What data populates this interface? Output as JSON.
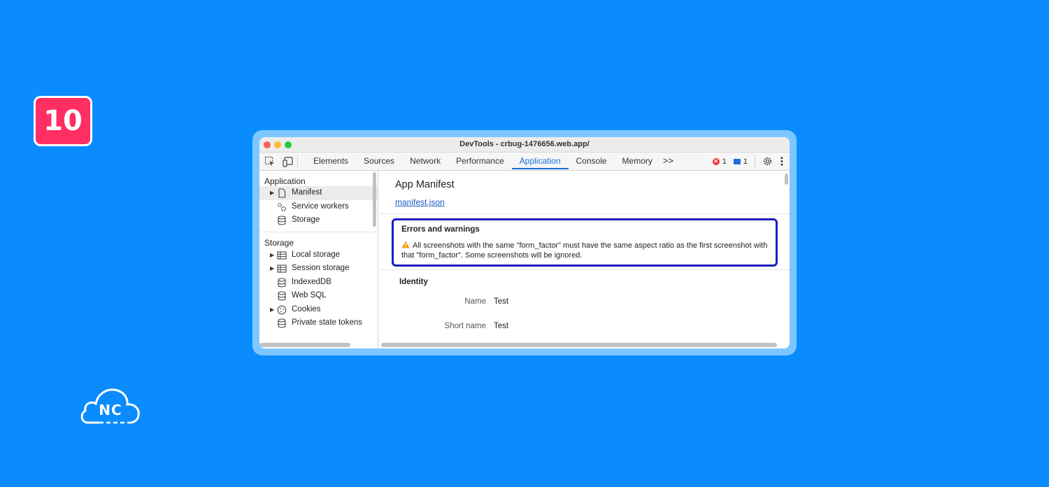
{
  "badge": "10",
  "logo_text": "NC",
  "window": {
    "title": "DevTools - crbug-1476656.web.app/"
  },
  "toolbar": {
    "tabs": [
      {
        "label": "Elements"
      },
      {
        "label": "Sources"
      },
      {
        "label": "Network"
      },
      {
        "label": "Performance"
      },
      {
        "label": "Application"
      },
      {
        "label": "Console"
      },
      {
        "label": "Memory"
      }
    ],
    "active_tab": "Application",
    "error_count": "1",
    "message_count": "1"
  },
  "sidebar": {
    "application_header": "Application",
    "application_items": [
      {
        "label": "Manifest",
        "icon": "file-icon",
        "expandable": true
      },
      {
        "label": "Service workers",
        "icon": "gears-icon",
        "expandable": false
      },
      {
        "label": "Storage",
        "icon": "database-icon",
        "expandable": false
      }
    ],
    "storage_header": "Storage",
    "storage_items": [
      {
        "label": "Local storage",
        "icon": "table-icon",
        "expandable": true
      },
      {
        "label": "Session storage",
        "icon": "table-icon",
        "expandable": true
      },
      {
        "label": "IndexedDB",
        "icon": "database-icon",
        "expandable": false
      },
      {
        "label": "Web SQL",
        "icon": "database-icon",
        "expandable": false
      },
      {
        "label": "Cookies",
        "icon": "cookie-icon",
        "expandable": true
      },
      {
        "label": "Private state tokens",
        "icon": "database-icon",
        "expandable": false
      }
    ]
  },
  "main": {
    "title": "App Manifest",
    "link": "manifest.json",
    "errors_heading": "Errors and warnings",
    "warning_text": "All screenshots with the same \"form_factor\" must have the same aspect ratio as the first screenshot with that \"form_factor\". Some screenshots will be ignored.",
    "identity_heading": "Identity",
    "rows": [
      {
        "label": "Name",
        "value": "Test"
      },
      {
        "label": "Short name",
        "value": "Test"
      }
    ]
  },
  "colors": {
    "background": "#0a8cff",
    "badge": "#ff2e63",
    "accent": "#1a6fd8",
    "highlight_border": "#1d1dbf"
  }
}
